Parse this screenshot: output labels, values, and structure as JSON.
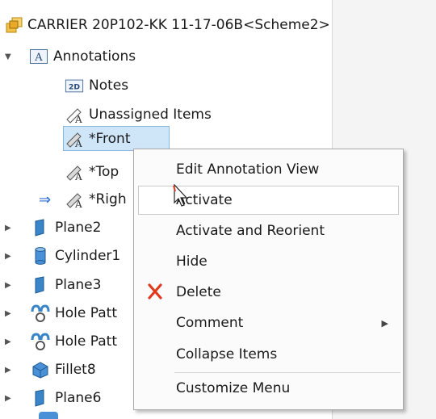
{
  "tree": {
    "root_label": "CARRIER 20P102-KK 11-17-06B<Scheme2>",
    "annotations_label": "Annotations",
    "notes_label": "Notes",
    "unassigned_label": "Unassigned Items",
    "front_label": "*Front",
    "top_label": "*Top",
    "right_label": "*Righ",
    "features": [
      {
        "label": "Plane2"
      },
      {
        "label": "Cylinder1"
      },
      {
        "label": "Plane3"
      },
      {
        "label": "Hole Patt"
      },
      {
        "label": "Hole Patt"
      },
      {
        "label": "Fillet8"
      },
      {
        "label": "Plane6"
      }
    ]
  },
  "context_menu": {
    "items": [
      {
        "label": "Edit Annotation View"
      },
      {
        "label": "Activate"
      },
      {
        "label": "Activate and Reorient"
      },
      {
        "label": "Hide"
      },
      {
        "label": "Delete"
      },
      {
        "label": "Comment"
      },
      {
        "label": "Collapse Items"
      },
      {
        "label": "Customize Menu"
      }
    ]
  },
  "colors": {
    "selection": "#cfe5f8",
    "delete_icon": "#e03a1e",
    "plane_icon": "#3a84c8",
    "arrow": "#2f6fd0"
  }
}
